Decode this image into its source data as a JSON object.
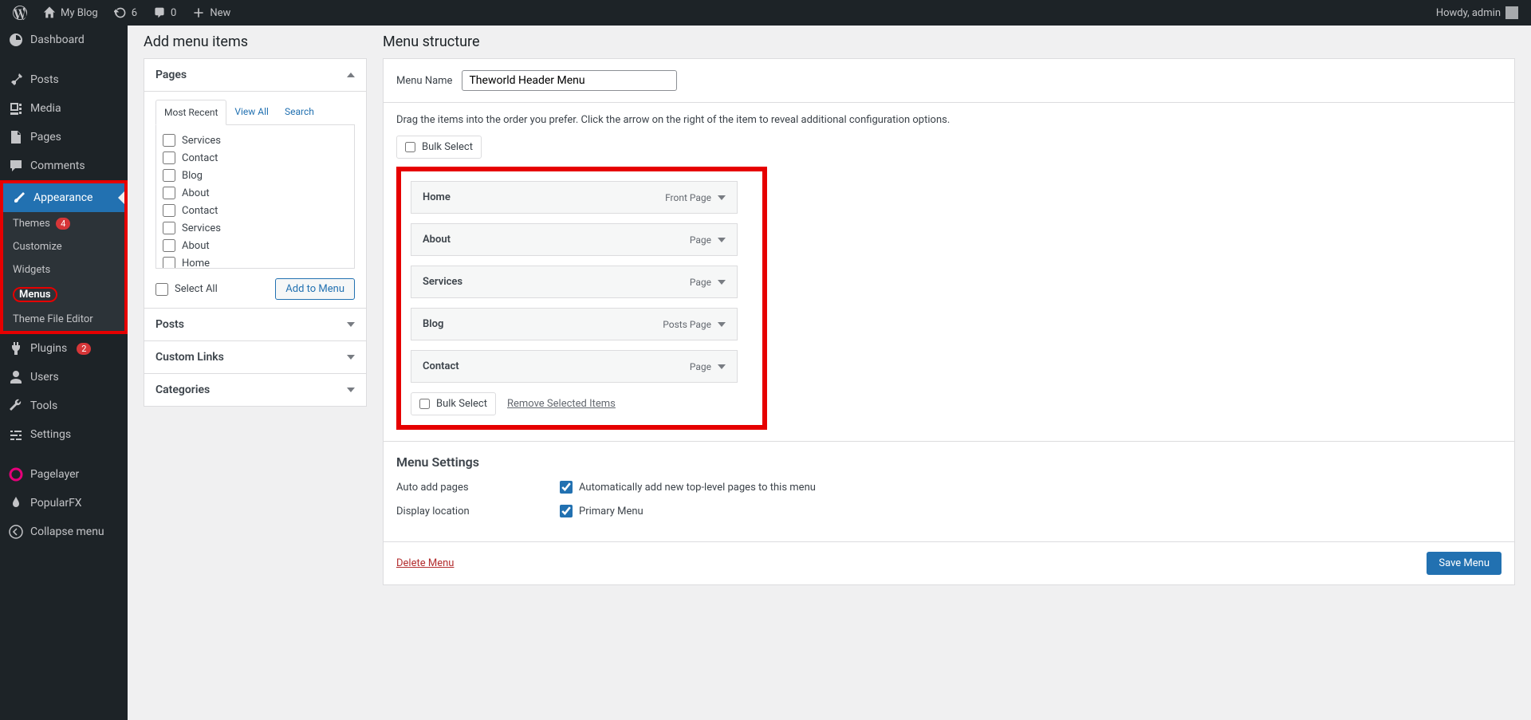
{
  "adminBar": {
    "siteName": "My Blog",
    "updates": "6",
    "comments": "0",
    "new": "New",
    "greeting": "Howdy, admin"
  },
  "sidebar": {
    "dashboard": "Dashboard",
    "posts": "Posts",
    "media": "Media",
    "pages": "Pages",
    "comments": "Comments",
    "appearance": "Appearance",
    "sub": {
      "themes": "Themes",
      "themesBadge": "4",
      "customize": "Customize",
      "widgets": "Widgets",
      "menus": "Menus",
      "themeFileEditor": "Theme File Editor"
    },
    "plugins": "Plugins",
    "pluginsBadge": "2",
    "users": "Users",
    "tools": "Tools",
    "settings": "Settings",
    "pagelayer": "Pagelayer",
    "popularfx": "PopularFX",
    "collapse": "Collapse menu"
  },
  "addMenu": {
    "title": "Add menu items",
    "pagesPanel": "Pages",
    "tabs": {
      "recent": "Most Recent",
      "viewAll": "View All",
      "search": "Search"
    },
    "pagesList": [
      "Services",
      "Contact",
      "Blog",
      "About",
      "Contact",
      "Services",
      "About",
      "Home"
    ],
    "selectAll": "Select All",
    "addToMenu": "Add to Menu",
    "postsPanel": "Posts",
    "customLinksPanel": "Custom Links",
    "categoriesPanel": "Categories"
  },
  "structure": {
    "title": "Menu structure",
    "menuNameLabel": "Menu Name",
    "menuNameValue": "Theworld Header Menu",
    "instructions": "Drag the items into the order you prefer. Click the arrow on the right of the item to reveal additional configuration options.",
    "bulkSelect": "Bulk Select",
    "removeSelected": "Remove Selected Items",
    "items": [
      {
        "label": "Home",
        "type": "Front Page"
      },
      {
        "label": "About",
        "type": "Page"
      },
      {
        "label": "Services",
        "type": "Page"
      },
      {
        "label": "Blog",
        "type": "Posts Page"
      },
      {
        "label": "Contact",
        "type": "Page"
      }
    ]
  },
  "settings": {
    "title": "Menu Settings",
    "autoAddLabel": "Auto add pages",
    "autoAddCheckbox": "Automatically add new top-level pages to this menu",
    "displayLocationLabel": "Display location",
    "primaryMenu": "Primary Menu",
    "deleteMenu": "Delete Menu",
    "saveMenu": "Save Menu"
  }
}
